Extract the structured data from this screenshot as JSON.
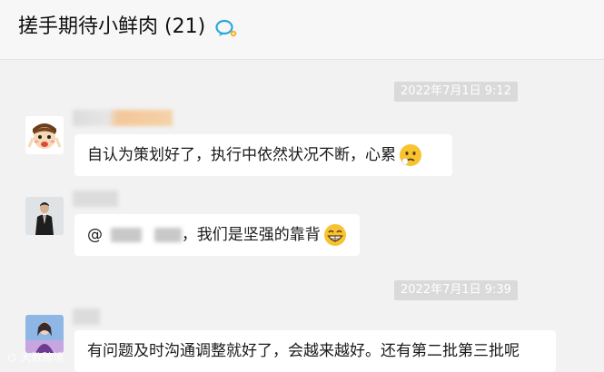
{
  "header": {
    "title": "搓手期待小鲜肉 (21)",
    "group_icon": "group-chat-icon",
    "accent_color": "#2aa7e0"
  },
  "messages": [
    {
      "type": "timestamp",
      "text": "2022年7月1日 9:12"
    },
    {
      "type": "message",
      "avatar": "cartoon-avatar",
      "text": "自认为策划好了，执行中依然状况不断，心累",
      "emoji": "worried-face-emoji"
    },
    {
      "type": "message",
      "avatar": "man-in-suit-avatar",
      "mention_prefix": "@",
      "text": "，我们是坚强的靠背",
      "emoji": "grinning-face-emoji"
    },
    {
      "type": "timestamp",
      "text": "2022年7月1日 9:39"
    },
    {
      "type": "message",
      "avatar": "woman-photo-avatar",
      "text": "有问题及时沟通调整就好了，会越来越好。还有第二批第三批呢"
    }
  ],
  "watermark": "大数跨境"
}
